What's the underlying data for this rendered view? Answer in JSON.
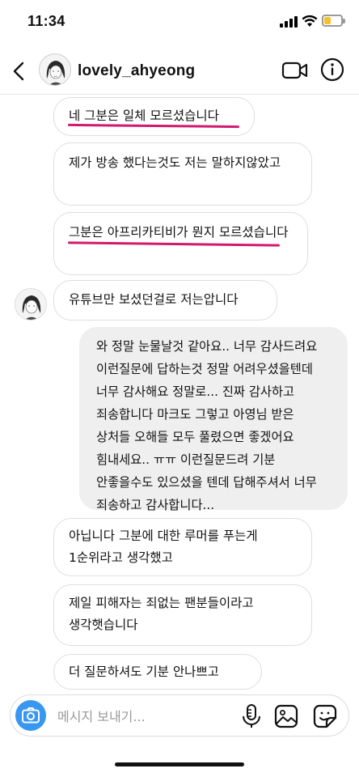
{
  "status_bar": {
    "time": "11:34"
  },
  "header": {
    "username": "lovely_ahyeong",
    "icons": [
      "back-chevron-icon",
      "avatar",
      "video-camera-icon",
      "info-icon"
    ]
  },
  "messages": [
    {
      "from": "them",
      "text": "네 그분은 일체 모르셨습니다",
      "underlined": true
    },
    {
      "from": "them",
      "text": "제가 방송 했다는것도 저는 말하지않았고"
    },
    {
      "from": "them",
      "text": "그분은 아프리카티비가 뭔지 모르셨습니다",
      "underlined": true
    },
    {
      "from": "them",
      "text": "유튜브만 보셨던걸로 저는압니다",
      "with_avatar": true
    },
    {
      "from": "me",
      "text": "와 정말 눈물날것 같아요.. 너무 감사드려요 이런질문에 답하는것 정말 어려우셨을텐데 너무 감사해요 정말로... 진짜 감사하고 죄송합니다 마크도 그렇고 아영님 받은 상처들 오해들 모두 풀렸으면 좋겠어요 힘내세요.. ㅠㅠ 이런질문드려 기분 안좋을수도 있으셨을 텐데 답해주셔서 너무 죄송하고 감사합니다..."
    },
    {
      "from": "them",
      "text": "아닙니다 그분에 대한 루머를 푸는게 1순위라고 생각했고"
    },
    {
      "from": "them",
      "text": "제일 피해자는 죄없는 팬분들이라고 생각햇습니다"
    },
    {
      "from": "them",
      "text": "더 질문하셔도 기분 안나쁘고"
    }
  ],
  "composer": {
    "placeholder": "메시지 보내기...",
    "icons": [
      "camera-icon",
      "microphone-icon",
      "gallery-icon",
      "sticker-icon"
    ]
  },
  "colors": {
    "accent_blue": "#3897f0",
    "sent_bubble": "#efefef",
    "underline_pink": "#d21a6c",
    "battery": "#f2c230"
  }
}
